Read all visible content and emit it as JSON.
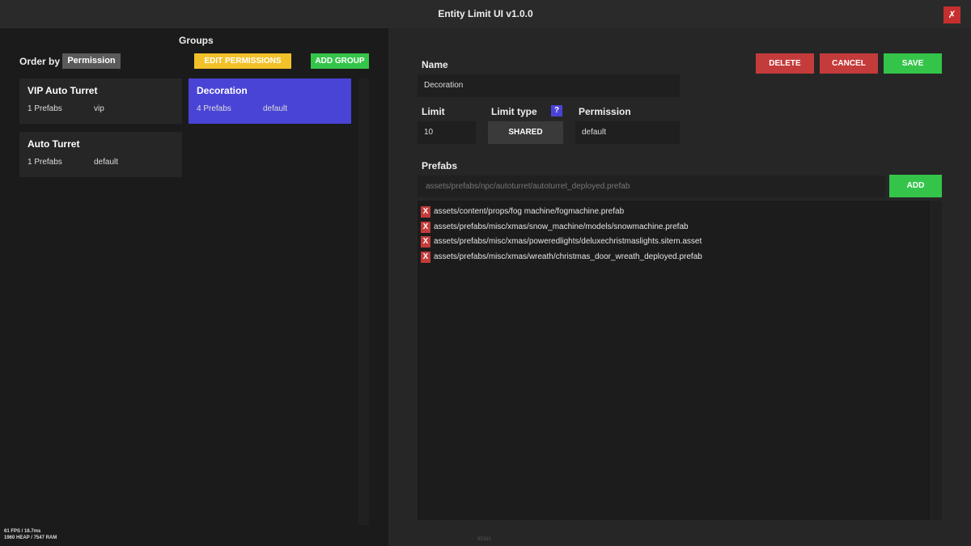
{
  "window": {
    "title": "Entity Limit UI v1.0.0",
    "close_label": "✗"
  },
  "left": {
    "groups_heading": "Groups",
    "order_by_label": "Order by",
    "order_by_value": "Permission",
    "edit_permissions_label": "EDIT PERMISSIONS",
    "add_group_label": "ADD GROUP",
    "groups": [
      {
        "name": "VIP Auto Turret",
        "prefab_count": "1 Prefabs",
        "permission": "vip",
        "selected": false
      },
      {
        "name": "Decoration",
        "prefab_count": "4 Prefabs",
        "permission": "default",
        "selected": true
      },
      {
        "name": "Auto Turret",
        "prefab_count": "1 Prefabs",
        "permission": "default",
        "selected": false
      }
    ]
  },
  "editor": {
    "name_label": "Name",
    "name_value": "Decoration",
    "limit_label": "Limit",
    "limit_value": "10",
    "limit_type_label": "Limit type",
    "limit_type_help": "?",
    "limit_type_value": "SHARED",
    "permission_label": "Permission",
    "permission_value": "default",
    "delete_label": "DELETE",
    "cancel_label": "CANCEL",
    "save_label": "SAVE",
    "prefabs_label": "Prefabs",
    "prefab_input_placeholder": "assets/prefabs/npc/autoturret/autoturret_deployed.prefab",
    "add_label": "ADD",
    "remove_label": "X",
    "prefabs": [
      "assets/content/props/fog machine/fogmachine.prefab",
      "assets/prefabs/misc/xmas/snow_machine/models/snowmachine.prefab",
      "assets/prefabs/misc/xmas/poweredlights/deluxechristmaslights.sitem.asset",
      "assets/prefabs/misc/xmas/wreath/christmas_door_wreath_deployed.prefab"
    ]
  },
  "status": {
    "fps_line": "61 FPS / 16.7ms",
    "mem_line": "1960 HEAP / 7547 RAM",
    "footer_code": "95331"
  },
  "colors": {
    "accent_blue": "#4a44d6",
    "accent_green": "#35c44a",
    "accent_red": "#c43b3b",
    "accent_yellow": "#f2c12a"
  }
}
